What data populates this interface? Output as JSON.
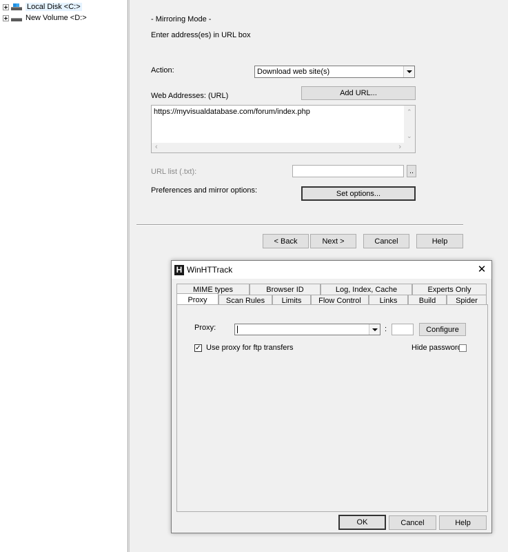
{
  "tree": {
    "items": [
      {
        "label": "Local Disk <C:>"
      },
      {
        "label": "New Volume <D:>"
      }
    ]
  },
  "main": {
    "mode_title": "- Mirroring Mode -",
    "instruction": "Enter address(es) in URL box",
    "action_label": "Action:",
    "action_value": "Download web site(s)",
    "web_addresses_label": "Web Addresses: (URL)",
    "add_url_button": "Add URL...",
    "url_text": "https://myvisualdatabase.com/forum/index.php",
    "url_list_label": "URL list (.txt):",
    "browse_button": "..",
    "preferences_label": "Preferences and mirror options:",
    "set_options_button": "Set options...",
    "back_button": "< Back",
    "next_button": "Next >",
    "cancel_button": "Cancel",
    "help_button": "Help"
  },
  "dialog": {
    "title": "WinHTTrack",
    "app_icon_letter": "H",
    "close_glyph": "✕",
    "tabs_row1": [
      "MIME types",
      "Browser ID",
      "Log, Index, Cache",
      "Experts Only"
    ],
    "tabs_row2": [
      "Proxy",
      "Scan Rules",
      "Limits",
      "Flow Control",
      "Links",
      "Build",
      "Spider"
    ],
    "active_tab": "Proxy",
    "proxy_label": "Proxy:",
    "proxy_value": "",
    "port_separator": ":",
    "port_value": "",
    "configure_button": "Configure",
    "use_proxy_ftp_label": "Use proxy for ftp transfers",
    "use_proxy_ftp_checked": true,
    "hide_password_label": "Hide password",
    "hide_password_checked": false,
    "ok_button": "OK",
    "cancel_button": "Cancel",
    "help_button": "Help"
  }
}
